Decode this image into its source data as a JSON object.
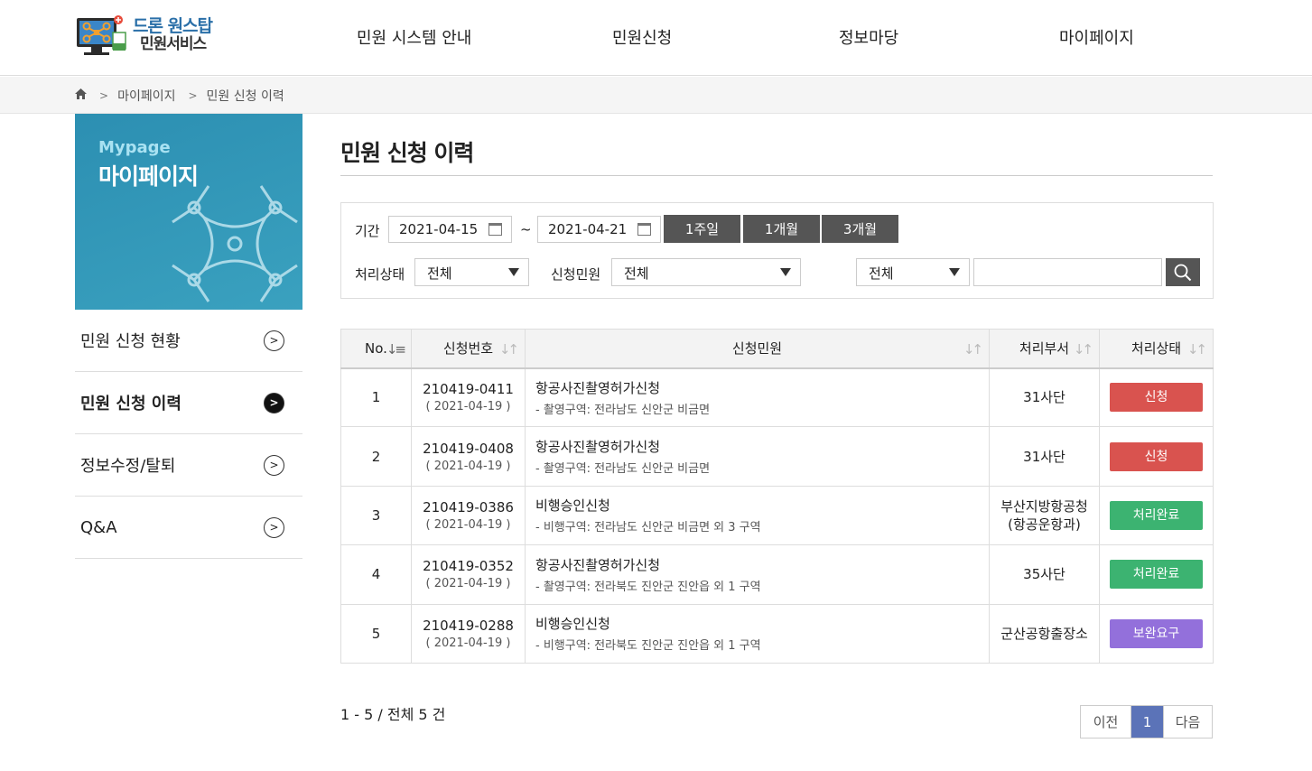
{
  "header": {
    "logo_line1": "드론 원스탑",
    "logo_line2": "민원서비스",
    "nav": [
      "민원 시스템 안내",
      "민원신청",
      "정보마당",
      "마이페이지"
    ]
  },
  "breadcrumb": [
    "마이페이지",
    "민원 신청 이력"
  ],
  "sidebar": {
    "banner_en": "Mypage",
    "banner_ko": "마이페이지",
    "items": [
      {
        "label": "민원 신청 현황",
        "active": false
      },
      {
        "label": "민원 신청 이력",
        "active": true
      },
      {
        "label": "정보수정/탈퇴",
        "active": false
      },
      {
        "label": "Q&A",
        "active": false
      }
    ]
  },
  "page_title": "민원 신청 이력",
  "filter": {
    "period_label": "기간",
    "date_from": "2021-04-15",
    "tilde": "~",
    "date_to": "2021-04-21",
    "period_buttons": [
      "1주일",
      "1개월",
      "3개월"
    ],
    "status_label": "처리상태",
    "status_value": "전체",
    "type_label": "신청민원",
    "type_value": "전체",
    "search_field_value": "전체",
    "search_text": ""
  },
  "table": {
    "headers": [
      "No.",
      "신청번호",
      "신청민원",
      "처리부서",
      "처리상태"
    ],
    "rows": [
      {
        "no": "1",
        "app_no": "210419-0411",
        "date": "( 2021-04-19 )",
        "title": "항공사진촬영허가신청",
        "sub": "- 촬영구역: 전라남도 신안군 비금면",
        "dept": "31사단",
        "dept2": "",
        "status": "신청",
        "color": "#d9534f"
      },
      {
        "no": "2",
        "app_no": "210419-0408",
        "date": "( 2021-04-19 )",
        "title": "항공사진촬영허가신청",
        "sub": "- 촬영구역: 전라남도 신안군 비금면",
        "dept": "31사단",
        "dept2": "",
        "status": "신청",
        "color": "#d9534f"
      },
      {
        "no": "3",
        "app_no": "210419-0386",
        "date": "( 2021-04-19 )",
        "title": "비행승인신청",
        "sub": "- 비행구역: 전라남도 신안군 비금면 외 3 구역",
        "dept": "부산지방항공청",
        "dept2": "(항공운항과)",
        "status": "처리완료",
        "color": "#3cb371"
      },
      {
        "no": "4",
        "app_no": "210419-0352",
        "date": "( 2021-04-19 )",
        "title": "항공사진촬영허가신청",
        "sub": "- 촬영구역: 전라북도 진안군 진안읍 외 1 구역",
        "dept": "35사단",
        "dept2": "",
        "status": "처리완료",
        "color": "#3cb371"
      },
      {
        "no": "5",
        "app_no": "210419-0288",
        "date": "( 2021-04-19 )",
        "title": "비행승인신청",
        "sub": "- 비행구역: 전라북도 진안군 진안읍 외 1 구역",
        "dept": "군산공항출장소",
        "dept2": "",
        "status": "보완요구",
        "color": "#9370db"
      }
    ]
  },
  "summary": "1 - 5 / 전체 5 건",
  "pagination": {
    "prev": "이전",
    "current": "1",
    "next": "다음",
    "active_color": "#5b73b8"
  }
}
